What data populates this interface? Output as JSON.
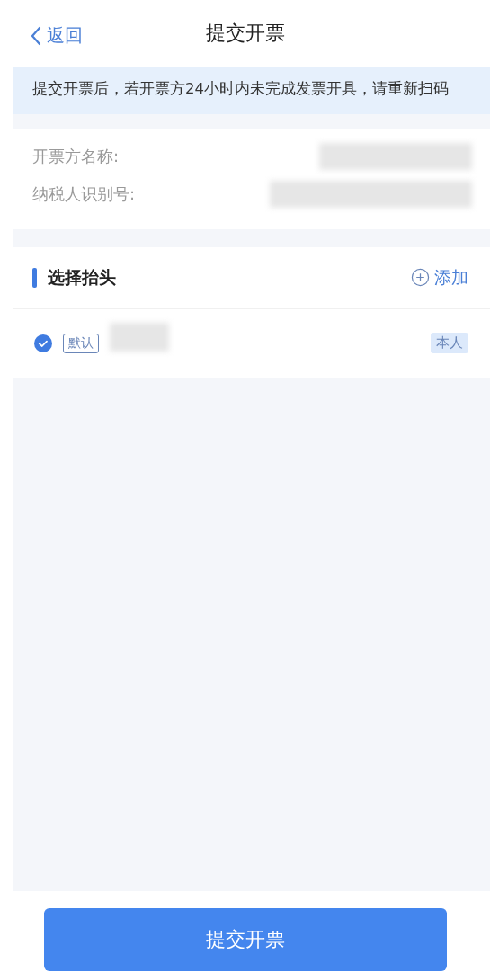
{
  "nav": {
    "back": "返回",
    "title": "提交开票"
  },
  "notice": "提交开票后，若开票方24小时内未完成发票开具，请重新扫码",
  "issuer_fields": [
    {
      "label": "开票方名称:"
    },
    {
      "label": "纳税人识别号:"
    }
  ],
  "header_section": {
    "title": "选择抬头",
    "add": "添加"
  },
  "headers": [
    {
      "selected": true,
      "default_tag": "默认",
      "relation": "本人"
    }
  ],
  "submit": "提交开票"
}
